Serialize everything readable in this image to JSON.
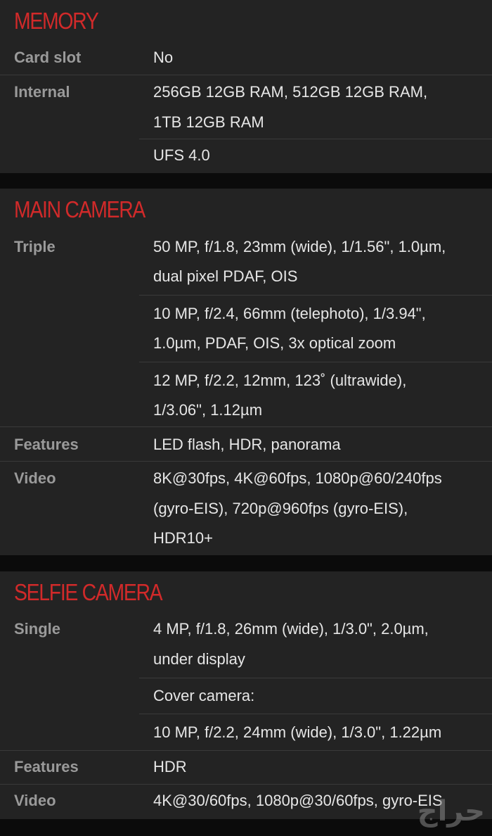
{
  "memory": {
    "title": "MEMORY",
    "card_slot_label": "Card slot",
    "card_slot_value": "No",
    "internal_label": "Internal",
    "internal_line1": "256GB 12GB RAM, 512GB 12GB RAM,",
    "internal_line2": "1TB 12GB RAM",
    "storage_type": "UFS 4.0"
  },
  "main_camera": {
    "title": "MAIN CAMERA",
    "triple_label": "Triple",
    "lens1_line1": "50 MP, f/1.8, 23mm (wide), 1/1.56\", 1.0µm,",
    "lens1_line2": "dual pixel PDAF, OIS",
    "lens2_line1": "10 MP, f/2.4, 66mm (telephoto), 1/3.94\",",
    "lens2_line2": "1.0µm, PDAF, OIS, 3x optical zoom",
    "lens3_line1": "12 MP, f/2.2, 12mm, 123˚ (ultrawide),",
    "lens3_line2": "1/3.06\", 1.12µm",
    "features_label": "Features",
    "features_value": "LED flash, HDR, panorama",
    "video_label": "Video",
    "video_line1": "8K@30fps, 4K@60fps, 1080p@60/240fps",
    "video_line2": "(gyro-EIS), 720p@960fps (gyro-EIS),",
    "video_line3": "HDR10+"
  },
  "selfie_camera": {
    "title": "SELFIE CAMERA",
    "single_label": "Single",
    "single_line1": "4 MP, f/1.8, 26mm (wide), 1/3.0\", 2.0µm,",
    "single_line2": "under display",
    "cover_label": "Cover camera:",
    "cover_value": "10 MP, f/2.2, 24mm (wide), 1/3.0\", 1.22µm",
    "features_label": "Features",
    "features_value": "HDR",
    "video_label": "Video",
    "video_value": "4K@30/60fps, 1080p@30/60fps, gyro-EIS"
  },
  "watermark": "حراج"
}
